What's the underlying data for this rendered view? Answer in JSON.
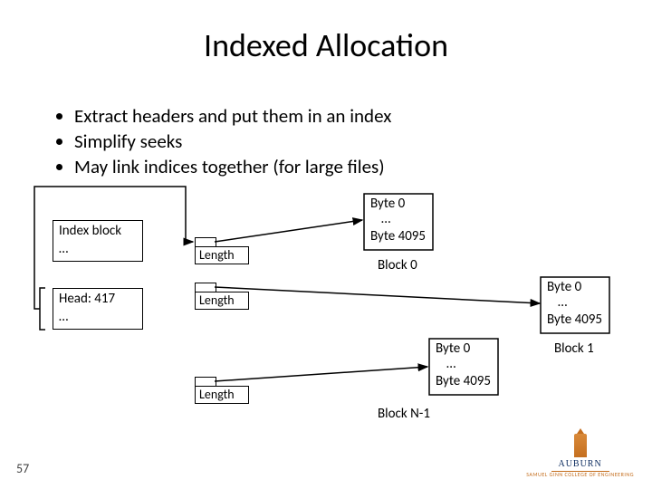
{
  "title": "Indexed Allocation",
  "bullets": [
    "Extract headers and put them in an index",
    "Simplify seeks",
    "May link indices together (for large files)"
  ],
  "index_block": {
    "line1": "Index block",
    "line2": "…"
  },
  "head_block": {
    "line1": "Head: 417",
    "line2": "…"
  },
  "length_label": "Length",
  "block0": {
    "byte_top": "Byte 0",
    "ell": "…",
    "byte_bot": "Byte 4095",
    "name": "Block 0"
  },
  "block1": {
    "byte_top": "Byte 0",
    "ell": "…",
    "byte_bot": "Byte 4095",
    "name": "Block 1"
  },
  "blockN": {
    "byte_top": "Byte 0",
    "ell": "…",
    "byte_bot": "Byte 4095",
    "name": "Block N-1"
  },
  "page_number": "57",
  "logo": {
    "name": "AUBURN",
    "sub": "SAMUEL GINN COLLEGE OF ENGINEERING"
  }
}
